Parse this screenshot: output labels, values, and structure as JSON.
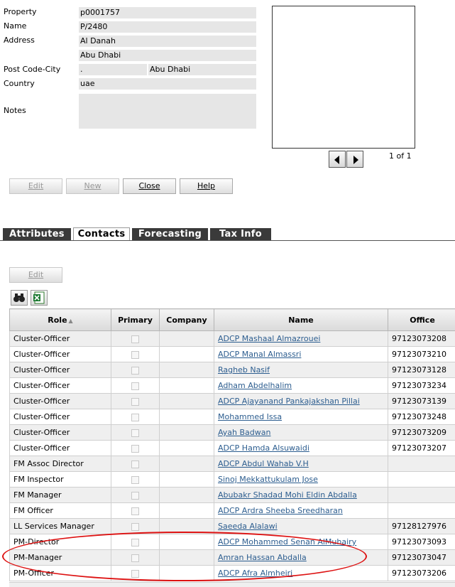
{
  "form": {
    "labels": {
      "property": "Property",
      "name": "Name",
      "address": "Address",
      "postcode_city": "Post Code-City",
      "country": "Country",
      "notes": "Notes"
    },
    "values": {
      "property": "p0001757",
      "name": "P/2480",
      "address1": "Al Danah",
      "address2": "Abu Dhabi",
      "postcode": ".",
      "city": "Abu Dhabi",
      "country": "uae",
      "notes": ""
    }
  },
  "photo": {
    "pager": "1 of 1",
    "prev_icon": "left-arrow-icon",
    "next_icon": "right-arrow-icon"
  },
  "buttons": {
    "edit": "Edit",
    "new": "New",
    "close": "Close",
    "help": "Help"
  },
  "tabs": [
    "Attributes",
    "Contacts",
    "Forecasting",
    "Tax Info"
  ],
  "active_tab": "Contacts",
  "contacts": {
    "edit_label": "Edit",
    "icons": [
      "binoculars-icon",
      "excel-export-icon"
    ],
    "columns": [
      "Role",
      "Primary",
      "Company",
      "Name",
      "Office"
    ],
    "sort_indicator": "▲",
    "rows": [
      {
        "role": "Cluster-Officer",
        "company": "",
        "name": "ADCP Mashaal Almazrouei",
        "office": "97123073208"
      },
      {
        "role": "Cluster-Officer",
        "company": "",
        "name": "ADCP Manal Almassri",
        "office": "97123073210"
      },
      {
        "role": "Cluster-Officer",
        "company": "",
        "name": "Ragheb Nasif",
        "office": "97123073128"
      },
      {
        "role": "Cluster-Officer",
        "company": "",
        "name": "Adham Abdelhalim",
        "office": "97123073234"
      },
      {
        "role": "Cluster-Officer",
        "company": "",
        "name": "ADCP Ajayanand Pankajakshan Pillai",
        "office": "97123073139"
      },
      {
        "role": "Cluster-Officer",
        "company": "",
        "name": "Mohammed Issa",
        "office": "97123073248"
      },
      {
        "role": "Cluster-Officer",
        "company": "",
        "name": "Ayah Badwan",
        "office": "97123073209"
      },
      {
        "role": "Cluster-Officer",
        "company": "",
        "name": "ADCP Hamda Alsuwaidi",
        "office": "97123073207"
      },
      {
        "role": "FM Assoc Director",
        "company": "",
        "name": "ADCP Abdul Wahab V.H",
        "office": ""
      },
      {
        "role": "FM Inspector",
        "company": "",
        "name": "Sinoj Mekkattukulam Jose",
        "office": ""
      },
      {
        "role": "FM Manager",
        "company": "",
        "name": "Abubakr Shadad Mohi Eldin Abdalla",
        "office": ""
      },
      {
        "role": "FM Officer",
        "company": "",
        "name": "ADCP Ardra Sheeba Sreedharan",
        "office": ""
      },
      {
        "role": "LL Services Manager",
        "company": "",
        "name": "Saeeda Alalawi",
        "office": "97128127976"
      },
      {
        "role": "PM-Director",
        "company": "",
        "name": "ADCP Mohammed Senan AlMuhairy",
        "office": "97123073093"
      },
      {
        "role": "PM-Manager",
        "company": "",
        "name": "Amran Hassan Abdalla",
        "office": "97123073047"
      },
      {
        "role": "PM-Officer",
        "company": "",
        "name": "ADCP Afra Almheiri",
        "office": "97123073206"
      }
    ]
  },
  "highlight_color": "#dd1111"
}
